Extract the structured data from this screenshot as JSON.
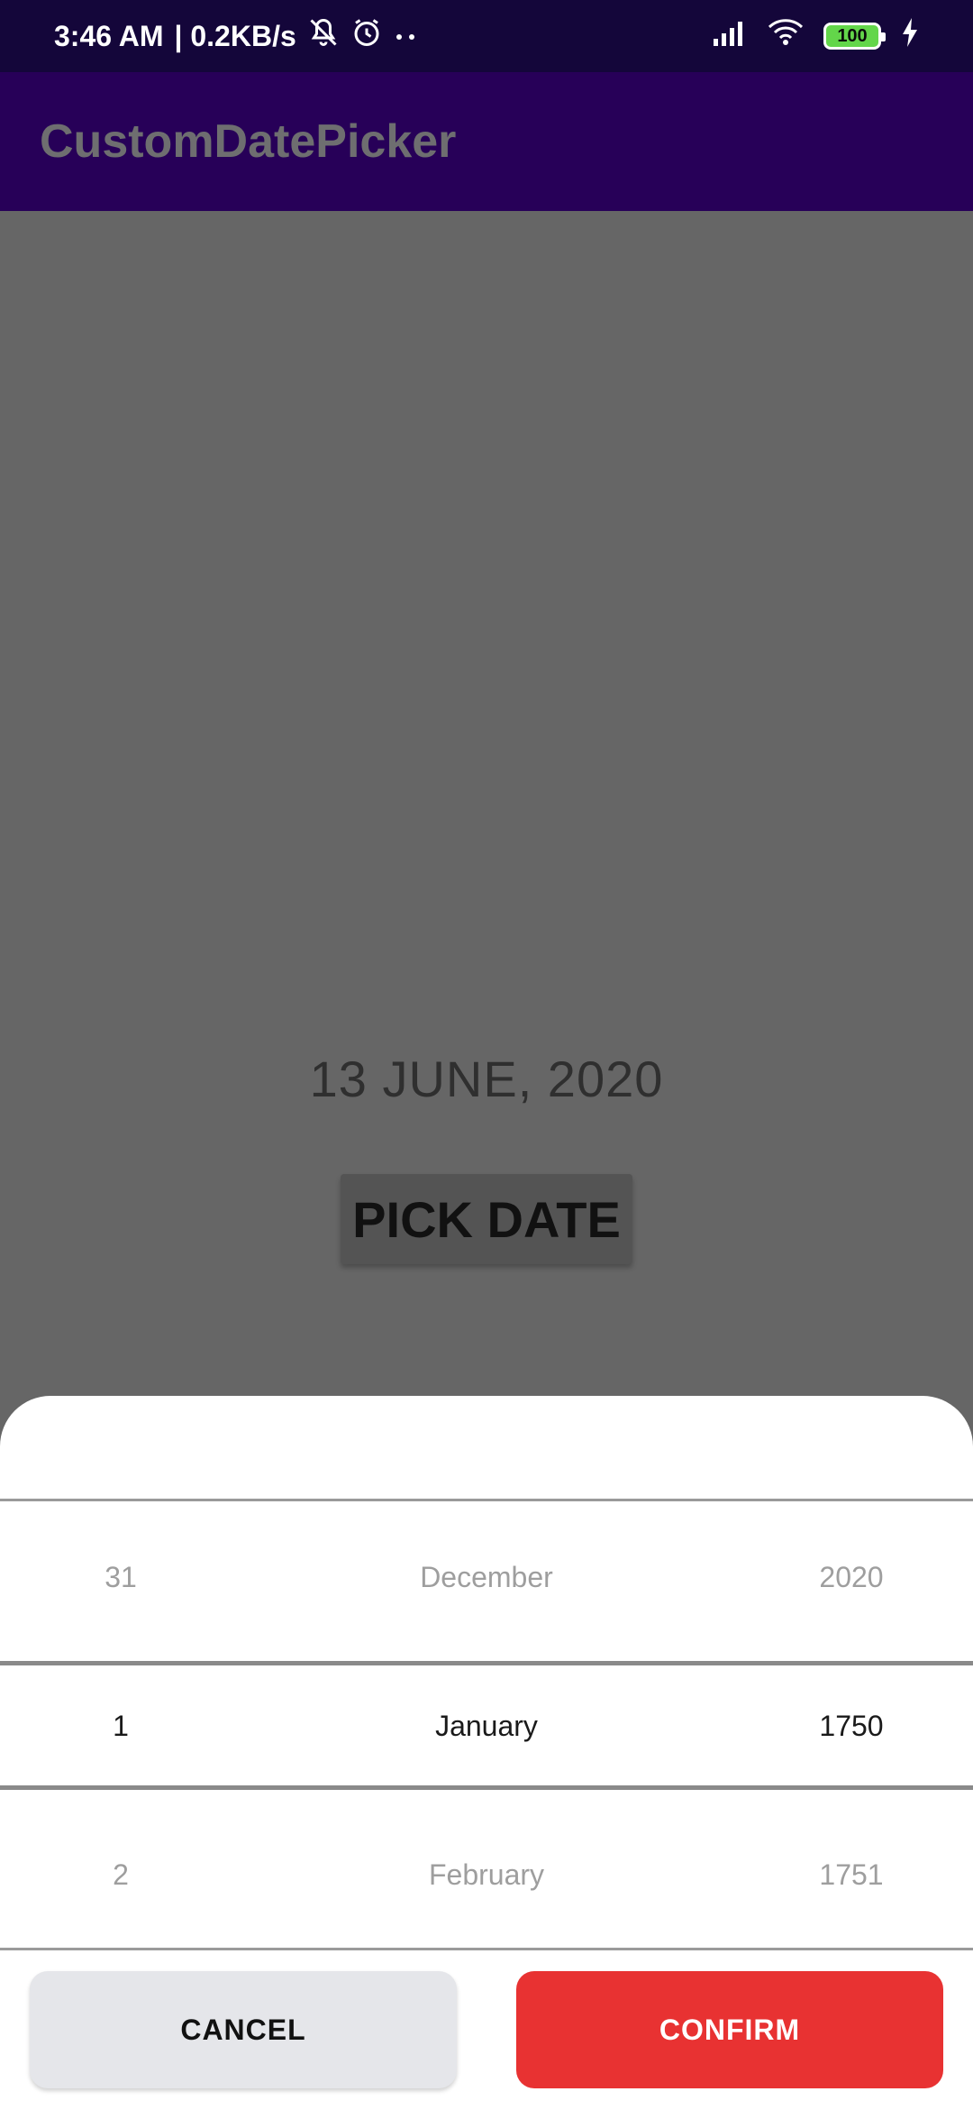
{
  "status_bar": {
    "time": "3:46 AM",
    "network_speed": "| 0.2KB/s",
    "battery_level": "100",
    "icons": [
      "muted-bell-icon",
      "alarm-icon",
      "more-dots-icon",
      "signal-icon",
      "wifi-icon",
      "battery-icon",
      "charging-bolt-icon"
    ]
  },
  "app_bar": {
    "title": "CustomDatePicker"
  },
  "main": {
    "date_text": "13 JUNE, 2020",
    "pick_button_label": "PICK DATE"
  },
  "picker": {
    "rows": [
      {
        "day": "31",
        "month": "December",
        "year": "2020",
        "state": "faded"
      },
      {
        "day": "1",
        "month": "January",
        "year": "1750",
        "state": "selected"
      },
      {
        "day": "2",
        "month": "February",
        "year": "1751",
        "state": "faded"
      }
    ],
    "cancel_label": "CANCEL",
    "confirm_label": "CONFIRM"
  },
  "colors": {
    "status_bar_bg": "#14063a",
    "app_bar_bg": "#270058",
    "overlay_bg": "#666666",
    "confirm_bg": "#e83232",
    "cancel_bg": "#e5e6ea"
  }
}
